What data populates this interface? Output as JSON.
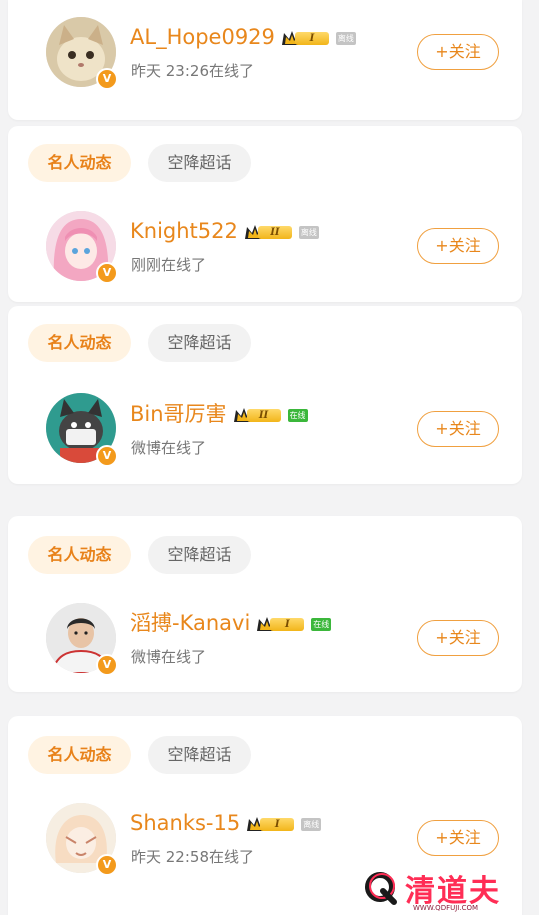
{
  "users": [
    {
      "name": "AL_Hope0929",
      "rank": "I",
      "presence": "离线",
      "presence_state": "offline",
      "status": "昨天 23:26在线了",
      "follow": "+关注",
      "avatar": "cat-avatar"
    },
    {
      "name": "Knight522",
      "rank": "II",
      "presence": "离线",
      "presence_state": "offline",
      "status": "刚刚在线了",
      "follow": "+关注",
      "avatar": "anime-girl-avatar"
    },
    {
      "name": "Bin哥厉害",
      "rank": "II",
      "presence": "在线",
      "presence_state": "online",
      "status": "微博在线了",
      "follow": "+关注",
      "avatar": "cartoon-dog-avatar"
    },
    {
      "name": "滔搏-Kanavi",
      "rank": "I",
      "presence": "在线",
      "presence_state": "online",
      "status": "微博在线了",
      "follow": "+关注",
      "avatar": "person-avatar"
    },
    {
      "name": "Shanks-15",
      "rank": "I",
      "presence": "离线",
      "presence_state": "offline",
      "status": "昨天 22:58在线了",
      "follow": "+关注",
      "avatar": "anime-sketch-avatar"
    }
  ],
  "tags": {
    "celebrity": "名人动态",
    "topic": "空降超话"
  },
  "verified_mark": "V",
  "watermark": {
    "text": "清道夫",
    "url": "WWW.QDFUJI.COM"
  },
  "colors": {
    "accent": "#e8871c",
    "online": "#3bb73b",
    "offline": "#c4c4c4",
    "watermark": "#ff2d55"
  }
}
